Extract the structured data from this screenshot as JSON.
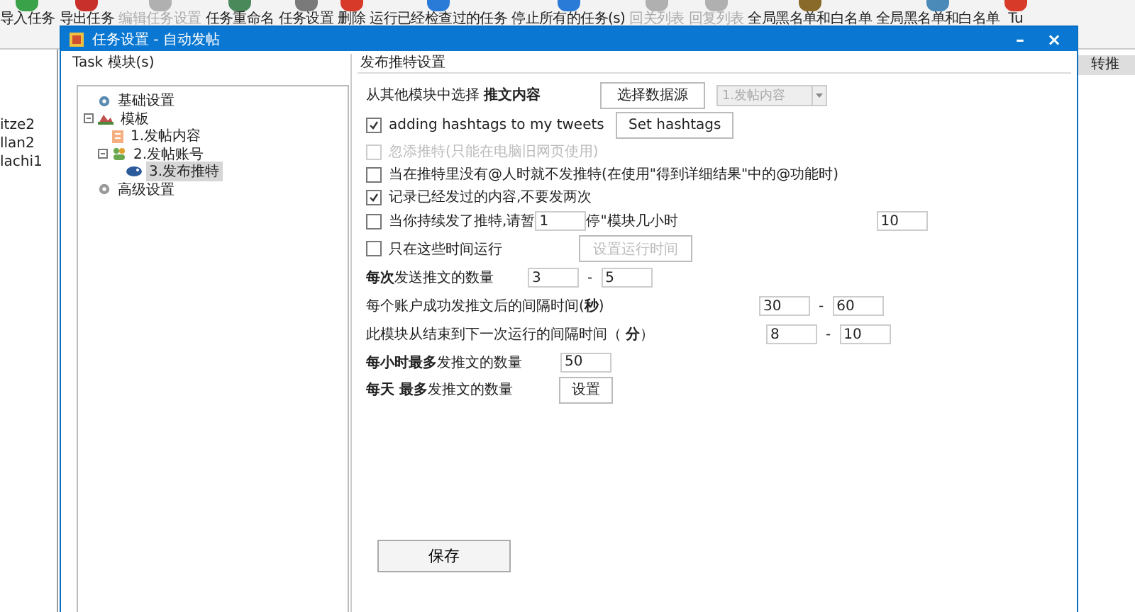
{
  "toolbar": [
    {
      "label": "导入任务",
      "disabled": false,
      "color": "#3aa34a"
    },
    {
      "label": "导出任务",
      "disabled": false,
      "color": "#c8312b"
    },
    {
      "label": "编辑任务设置",
      "disabled": true,
      "color": "#b0b0b0"
    },
    {
      "label": "任务重命名",
      "disabled": false,
      "color": "#4a8a5a"
    },
    {
      "label": "任务设置",
      "disabled": false,
      "color": "#7a7a7a"
    },
    {
      "label": "删除",
      "disabled": false,
      "color": "#d83a2a"
    },
    {
      "label": "运行已经检查过的任务",
      "disabled": false,
      "color": "#2a7ad8"
    },
    {
      "label": "停止所有的任务(s)",
      "disabled": false,
      "color": "#2a7ad8"
    },
    {
      "label": "回关列表",
      "disabled": true,
      "color": "#b0b0b0"
    },
    {
      "label": "回复列表",
      "disabled": true,
      "color": "#b0b0b0"
    },
    {
      "label": "全局黑名单和白名单",
      "disabled": false,
      "color": "#8a6a2a"
    },
    {
      "label": "全局黑名单和白名单",
      "disabled": false,
      "color": "#4a8ab8"
    },
    {
      "label": "Tu",
      "disabled": false,
      "color": "#d83a2a"
    }
  ],
  "accounts": [
    "itze2",
    "llan2",
    "lachi1"
  ],
  "right_column": {
    "header": "转推"
  },
  "dialog": {
    "title": "任务设置 - 自动发帖",
    "minimize": "–",
    "close": "×",
    "modules_group": "Task 模块(s)",
    "tree": [
      {
        "label": "基础设置",
        "selected": false
      },
      {
        "label": "模板",
        "selected": false,
        "expanded": true,
        "children": [
          {
            "label": "1.发帖内容",
            "selected": false
          },
          {
            "label": "2.发帖账号",
            "selected": false,
            "expanded": true,
            "children": [
              {
                "label": "3.发布推特",
                "selected": true
              }
            ]
          }
        ]
      },
      {
        "label": "高级设置",
        "selected": false
      }
    ],
    "settings_group": "发布推特设置",
    "rows": [
      {
        "kind": "source",
        "label": "从其他模块中选择 **推文内容**",
        "button": "选择数据源",
        "combo": "1.发帖内容"
      },
      {
        "kind": "check_button",
        "label": "adding hashtags to my tweets",
        "checked": true,
        "disabled": false,
        "button": "Set hashtags",
        "button_disabled": false
      },
      {
        "kind": "check",
        "label": "忽添推特(只能在电脑旧网页使用)",
        "checked": false,
        "disabled": true
      },
      {
        "kind": "check",
        "label": "当在推特里没有@人时就不发推特(在使用\"得到详细结果\"中的@功能时)",
        "checked": false,
        "disabled": false
      },
      {
        "kind": "check",
        "label": "记录已经发过的内容,不要发两次",
        "checked": true,
        "disabled": false
      },
      {
        "kind": "check_pause",
        "label": "当你持续发了推特,请暂",
        "checked": false,
        "disabled": false,
        "value": "1",
        "suffix": "停\"模块几小时",
        "value2": "10"
      },
      {
        "kind": "check_button",
        "label": "只在这些时间运行",
        "checked": false,
        "disabled": false,
        "button": "设置运行时间",
        "button_disabled": true
      },
      {
        "kind": "range",
        "label": "**每次**发送推文的数量",
        "from": "3",
        "dash": "-",
        "to": "5"
      },
      {
        "kind": "range",
        "label": "每个账户成功发推文后的间隔时间(**秒**)",
        "from": "30",
        "dash": "-",
        "to": "60"
      },
      {
        "kind": "range",
        "label": "此模块从结束到下一次运行的间隔时间（ **分**）",
        "from": "8",
        "dash": "-",
        "to": "10"
      },
      {
        "kind": "single",
        "label": "**每小时最多**发推文的数量",
        "value": "50"
      },
      {
        "kind": "button",
        "label": "**每天 最多**发推文的数量",
        "button": "设置"
      }
    ],
    "save": "保存"
  }
}
